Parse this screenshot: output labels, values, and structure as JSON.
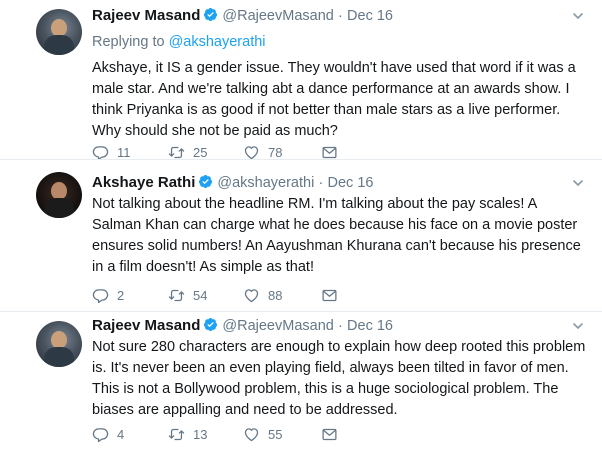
{
  "colors": {
    "link": "#1da1f2",
    "secondary_text": "#657786",
    "primary_text": "#14171a",
    "divider": "#e6ecf0",
    "verified_badge": "#1da1f2"
  },
  "tweets": [
    {
      "author_name": "Rajeev Masand",
      "verified": true,
      "handle": "@RajeevMasand",
      "separator": "·",
      "date": "Dec 16",
      "replying_to_label": "Replying to",
      "replying_to_handle": "@akshayerathi",
      "text": "Akshaye, it IS a gender issue. They wouldn't have used that word if it was a male star. And we're talking abt a dance performance at an awards show. I think Priyanka is as good if not better than male stars as a live performer. Why should she not be paid as much?",
      "replies": "11",
      "retweets": "25",
      "likes": "78",
      "icons": [
        "reply-icon",
        "retweet-icon",
        "like-icon",
        "message-icon"
      ]
    },
    {
      "author_name": "Akshaye Rathi",
      "verified": true,
      "handle": "@akshayerathi",
      "separator": "·",
      "date": "Dec 16",
      "text": "Not talking about the headline RM. I'm talking about the pay scales! A Salman Khan can charge what he does because his face on a movie poster ensures solid numbers! An Aayushman Khurana can't because his presence in a film doesn't! As simple as that!",
      "replies": "2",
      "retweets": "54",
      "likes": "88",
      "icons": [
        "reply-icon",
        "retweet-icon",
        "like-icon",
        "message-icon"
      ]
    },
    {
      "author_name": "Rajeev Masand",
      "verified": true,
      "handle": "@RajeevMasand",
      "separator": "·",
      "date": "Dec 16",
      "text": "Not sure 280 characters are enough to explain how deep rooted this problem is. It's never been an even playing field, always been tilted in favor of men. This is not a Bollywood problem, this is a huge sociological problem. The biases are appalling and need to be addressed.",
      "replies": "4",
      "retweets": "13",
      "likes": "55",
      "icons": [
        "reply-icon",
        "retweet-icon",
        "like-icon",
        "message-icon"
      ]
    }
  ]
}
